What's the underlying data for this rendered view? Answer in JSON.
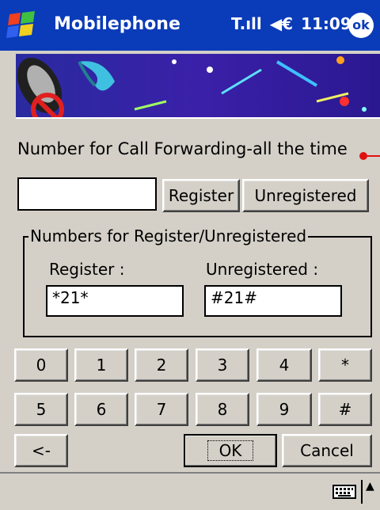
{
  "titlebar": {
    "app_title": "Mobilephone",
    "time": "11:09",
    "ok_label": "ok",
    "signal_glyph": "T.ıll",
    "speaker_glyph": "◀€"
  },
  "main": {
    "label": "Number for Call Forwarding-all the time",
    "number_value": "",
    "register_button": "Register",
    "unregistered_button": "Unregistered"
  },
  "group": {
    "legend": "Numbers for Register/Unregistered",
    "register_label": "Register :",
    "register_value": "*21*",
    "unregistered_label": "Unregistered :",
    "unregistered_value": "#21#"
  },
  "keypad": {
    "row1": [
      "0",
      "1",
      "2",
      "3",
      "4",
      "*"
    ],
    "row2": [
      "5",
      "6",
      "7",
      "8",
      "9",
      "#"
    ]
  },
  "actions": {
    "back": "<-",
    "ok": "OK",
    "cancel": "Cancel"
  },
  "taskbar": {
    "sip_arrow": "▲"
  },
  "colors": {
    "titlebar": "#0a3bb8",
    "background": "#d4d0c8",
    "accent_red": "#e01010"
  }
}
